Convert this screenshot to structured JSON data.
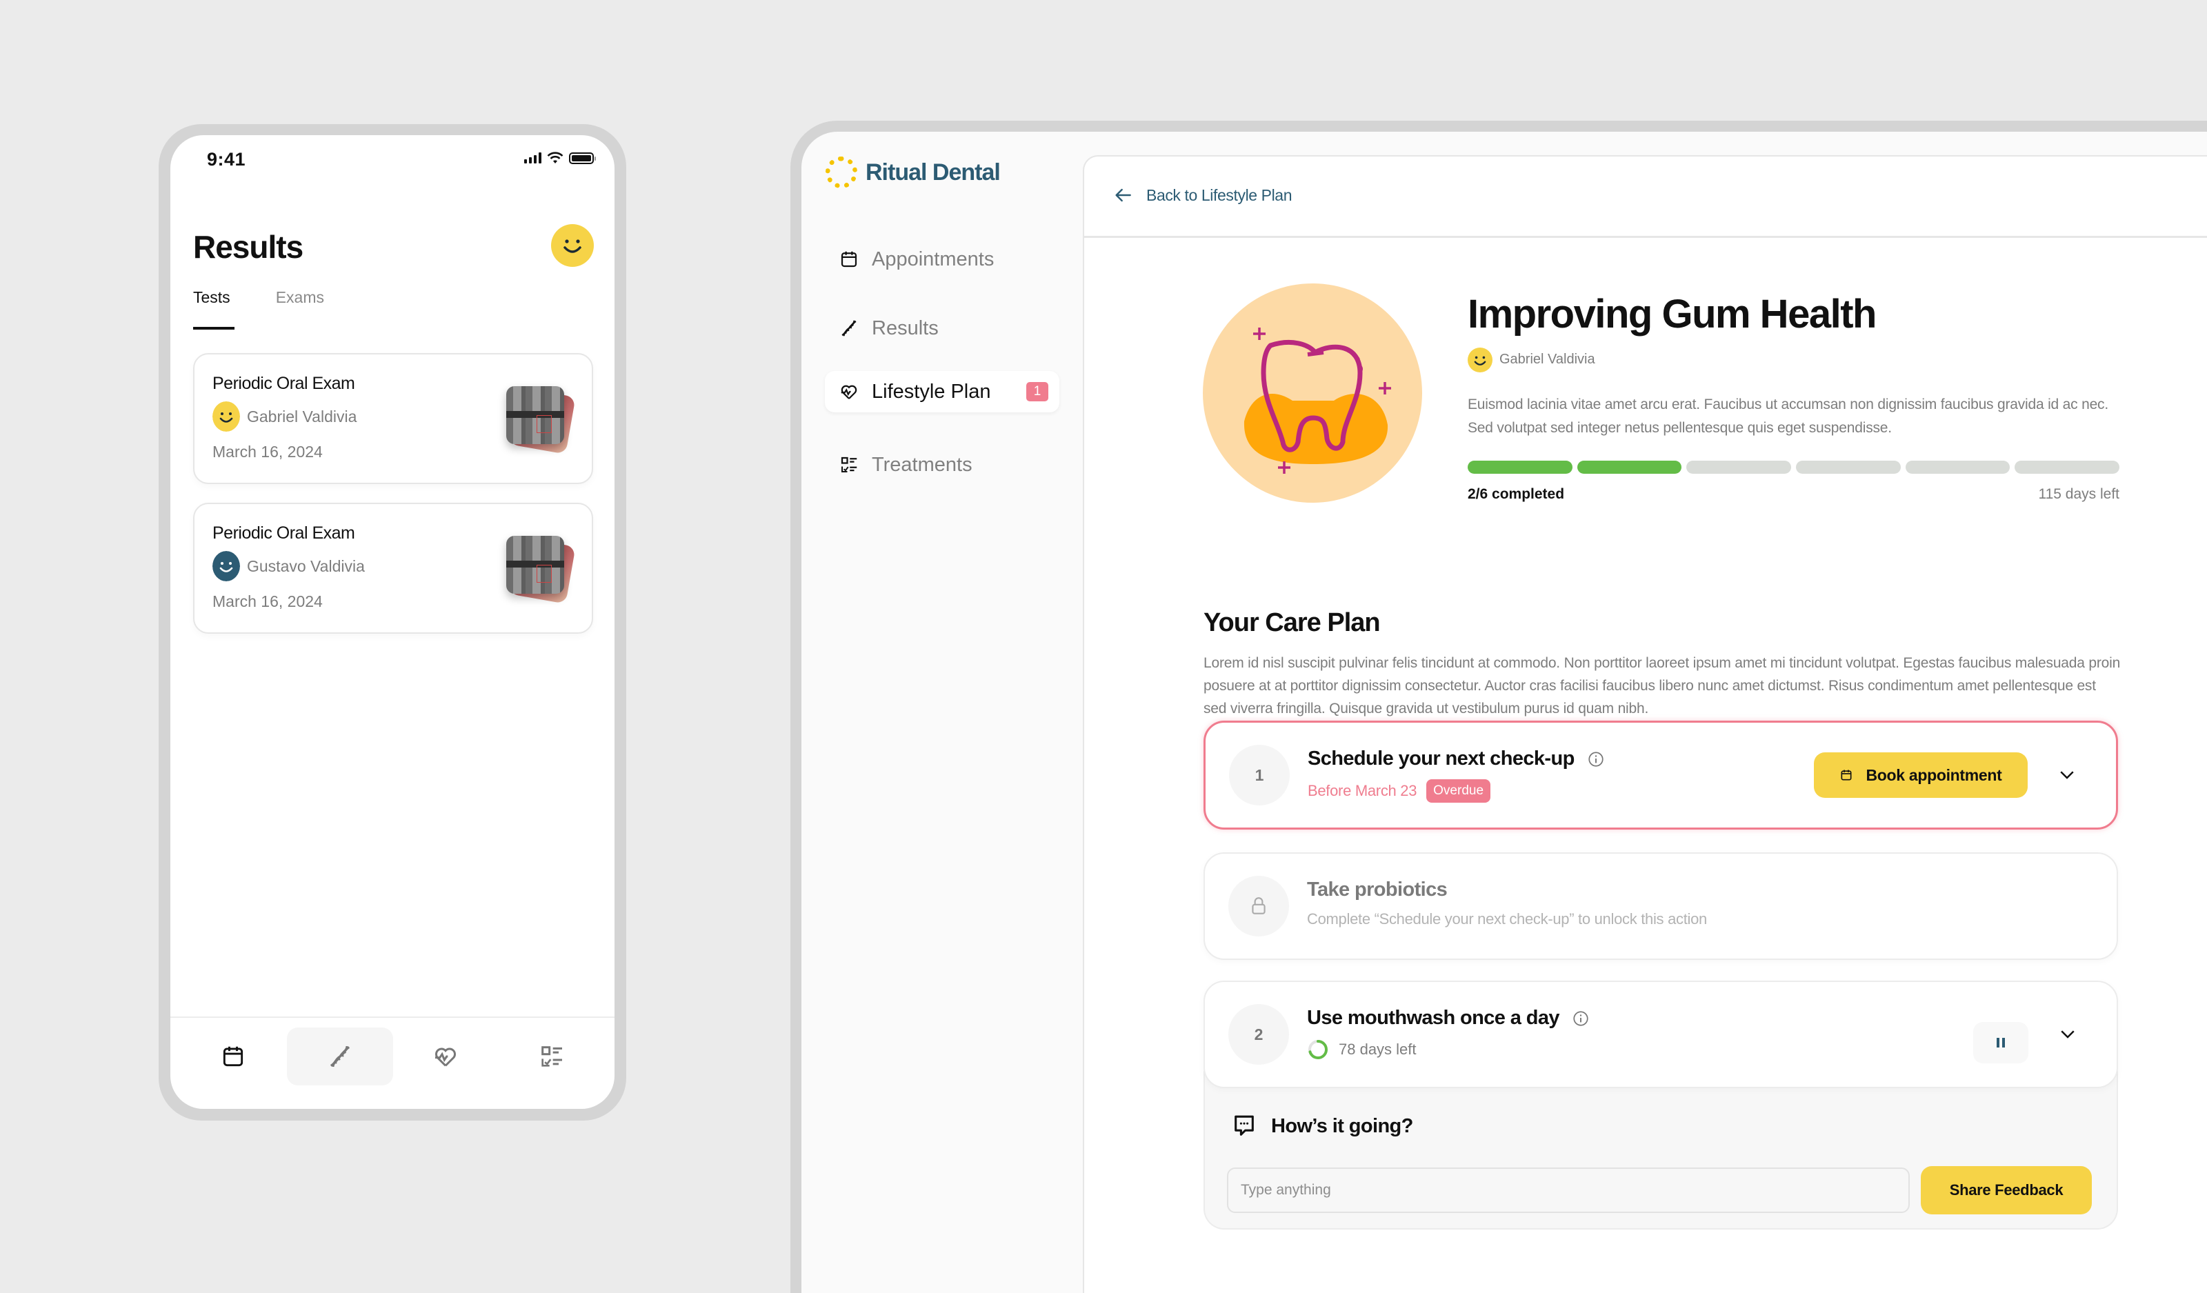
{
  "phone": {
    "status_time": "9:41",
    "title": "Results",
    "tabs": [
      {
        "label": "Tests",
        "active": true
      },
      {
        "label": "Exams",
        "active": false
      }
    ],
    "cards": [
      {
        "title": "Periodic Oral Exam",
        "person": "Gabriel Valdivia",
        "avatar_color": "#f6d347",
        "date": "March 16, 2024"
      },
      {
        "title": "Periodic Oral Exam",
        "person": "Gustavo Valdivia",
        "avatar_color": "#2c5b73",
        "date": "March 16, 2024"
      }
    ],
    "bottom_nav": [
      {
        "icon": "calendar-icon",
        "active": false
      },
      {
        "icon": "dna-icon",
        "active": true
      },
      {
        "icon": "heart-pulse-icon",
        "active": false
      },
      {
        "icon": "checklist-icon",
        "active": false
      }
    ]
  },
  "app": {
    "brand": "Ritual Dental",
    "brand_color": "#2c5b73",
    "accent_yellow": "#f6d347",
    "alert_pink": "#f07c8e",
    "progress_green": "#63bc47",
    "sidebar": [
      {
        "label": "Appointments",
        "icon": "calendar-icon",
        "active": false
      },
      {
        "label": "Results",
        "icon": "dna-icon",
        "active": false
      },
      {
        "label": "Lifestyle Plan",
        "icon": "heart-pulse-icon",
        "active": true,
        "badge": "1"
      },
      {
        "label": "Treatments",
        "icon": "checklist-icon",
        "active": false
      }
    ],
    "back_link": "Back to Lifestyle Plan",
    "plan": {
      "title": "Improving Gum Health",
      "person": "Gabriel Valdivia",
      "description": "Euismod lacinia vitae amet arcu erat. Faucibus ut accumsan non dignissim faucibus gravida id ac nec. Sed volutpat sed integer netus pellentesque quis eget suspendisse.",
      "completed": 2,
      "total": 6,
      "completed_label": "2/6 completed",
      "days_left_label": "115 days left"
    },
    "care_plan": {
      "title": "Your Care Plan",
      "description": "Lorem id nisl suscipit pulvinar felis tincidunt at commodo. Non porttitor laoreet ipsum amet mi tincidunt volutpat. Egestas faucibus malesuada proin posuere at at porttitor dignissim consectetur. Auctor cras facilisi faucibus libero nunc amet dictumst. Risus condimentum amet pellentesque est sed viverra fringilla. Quisque gravida ut vestibulum purus id quam nibh.",
      "tasks": [
        {
          "number": "1",
          "title": "Schedule your next check-up",
          "due": "Before March 23",
          "status_badge": "Overdue",
          "action_label": "Book appointment"
        },
        {
          "title": "Take probiotics",
          "locked_message": "Complete “Schedule your next check-up” to unlock this action"
        },
        {
          "number": "2",
          "title": "Use mouthwash once a day",
          "days_left": "78 days left",
          "ring_progress": 0.7
        }
      ],
      "feedback": {
        "title": "How’s it going?",
        "input_value": "",
        "input_placeholder": "Type anything",
        "button_label": "Share Feedback"
      }
    }
  }
}
